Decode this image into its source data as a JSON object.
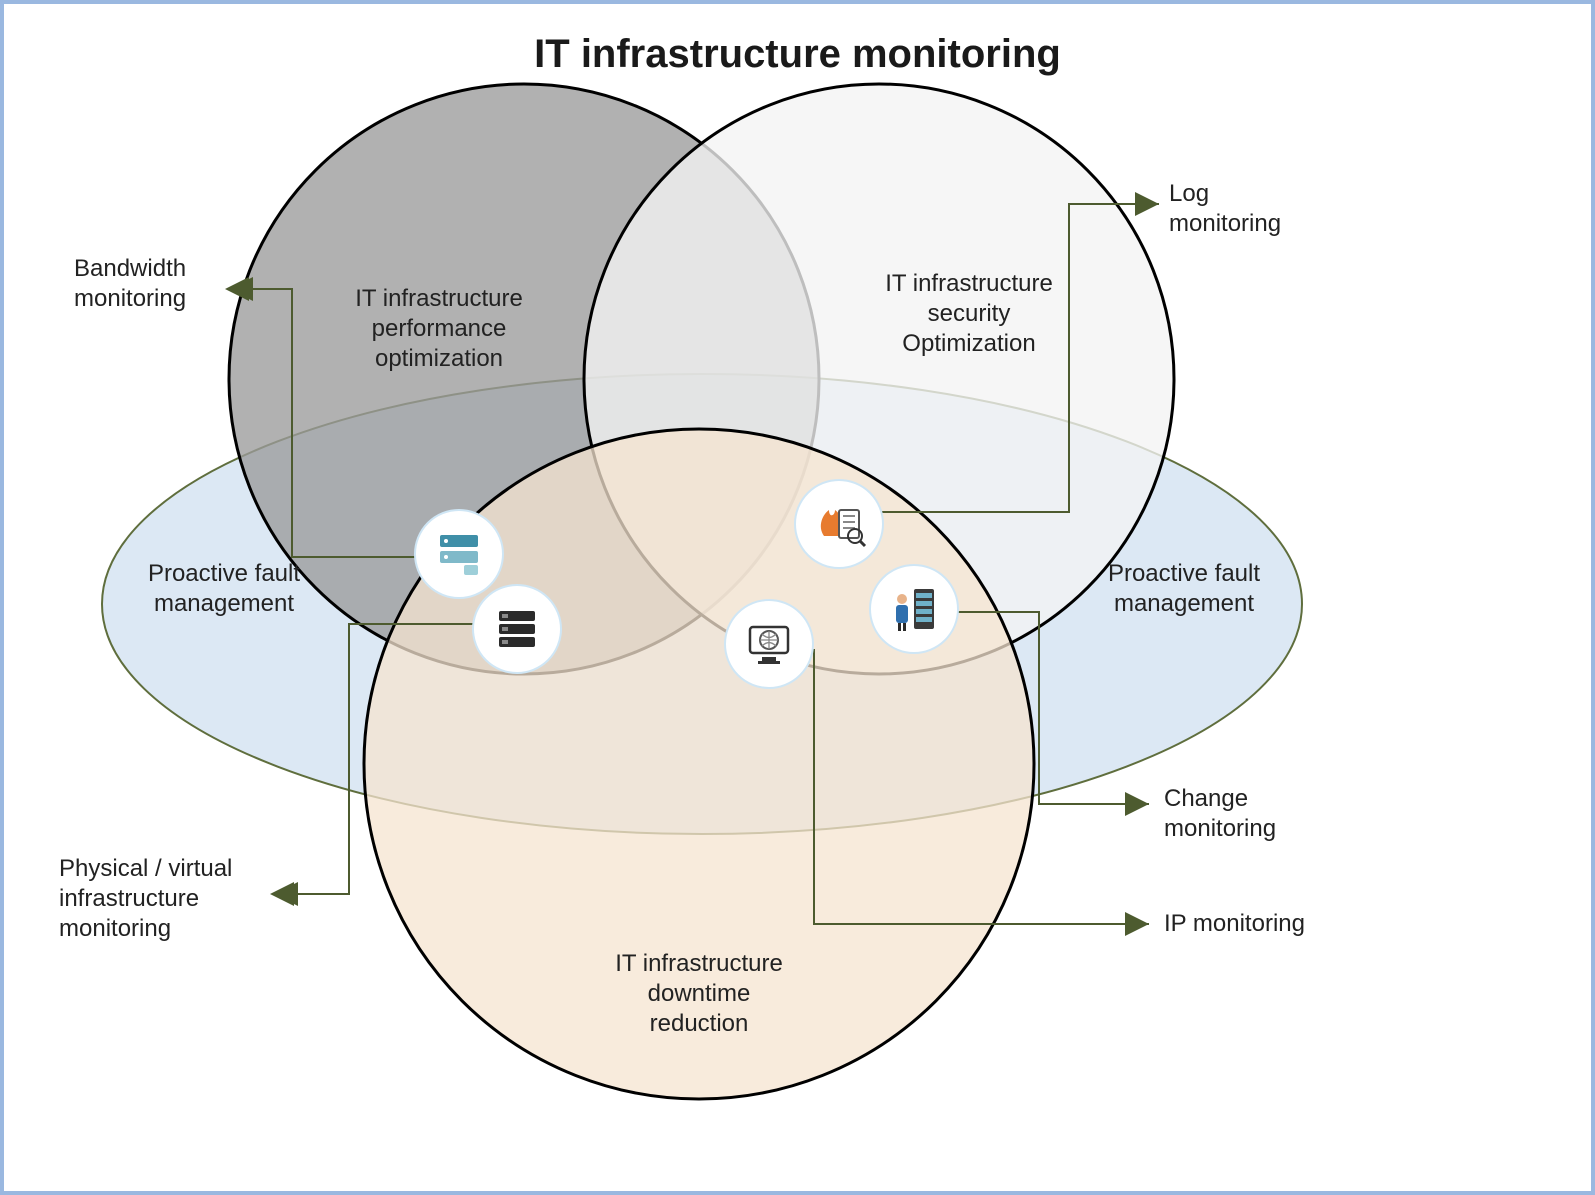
{
  "title": "IT infrastructure monitoring",
  "circles": {
    "performance": {
      "label": "IT infrastructure\nperformance\noptimization",
      "fill": "#9b9b9b"
    },
    "security": {
      "label": "IT infrastructure\nsecurity\nOptimization",
      "fill": "#f2f2f2"
    },
    "downtime": {
      "label": "IT infrastructure\ndowntime\nreduction",
      "fill": "#f6e4d0"
    }
  },
  "ellipse": {
    "left_label": "Proactive fault\nmanagement",
    "right_label": "Proactive fault\nmanagement",
    "fill": "#d6e4f2"
  },
  "callouts": {
    "bandwidth": "Bandwidth\nmonitoring",
    "physical": "Physical / virtual\ninfrastructure\nmonitoring",
    "log": "Log\nmonitoring",
    "change": "Change\nmonitoring",
    "ip": "IP monitoring"
  },
  "icons": {
    "server_rack": "server-rack-icon",
    "server_stack": "server-stack-icon",
    "firewall_log": "firewall-log-icon",
    "globe_monitor": "globe-monitor-icon",
    "admin_server": "admin-server-icon"
  },
  "colors": {
    "line": "#4d5b2f",
    "border": "#000"
  }
}
